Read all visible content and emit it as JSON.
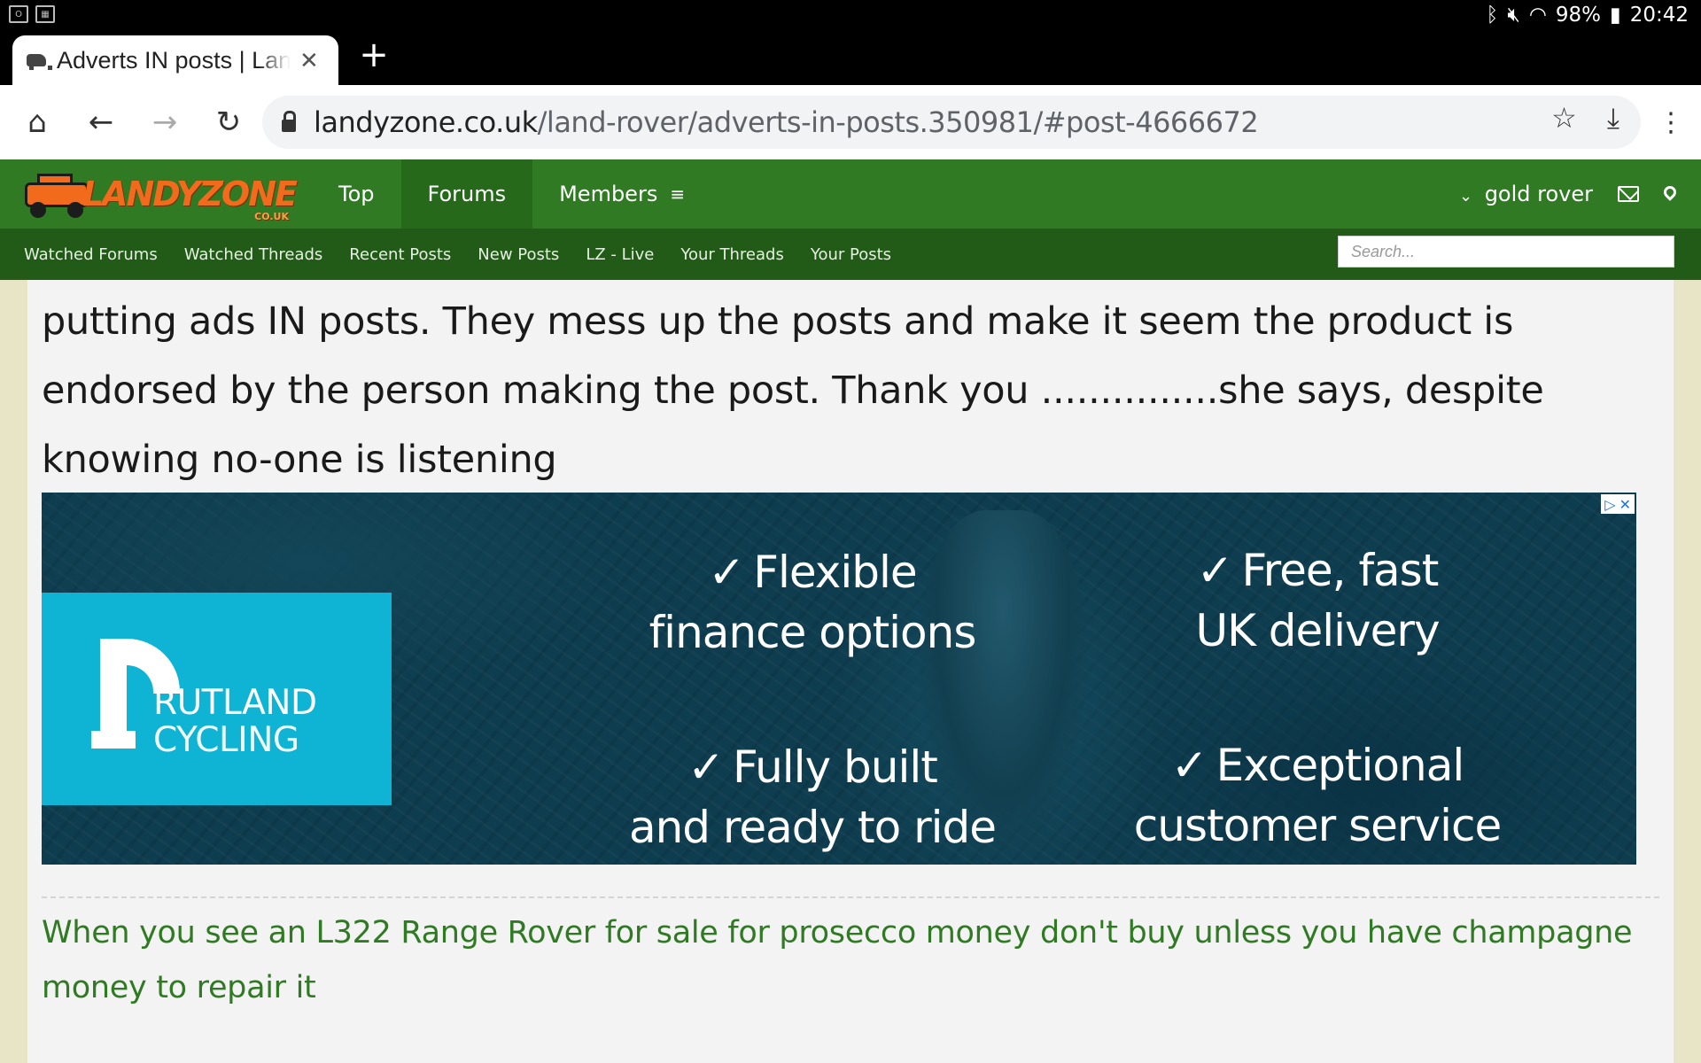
{
  "status_bar": {
    "battery": "98%",
    "time": "20:42",
    "icons": [
      "bluetooth-icon",
      "mute-icon",
      "wifi-icon",
      "battery-icon"
    ]
  },
  "browser": {
    "tab_title": "Adverts IN posts | LandyZone",
    "url_host": "landyzone.co.uk",
    "url_path": "/land-rover/adverts-in-posts.350981/#post-4666672"
  },
  "site": {
    "logo_text": "LANDYZONE",
    "logo_suffix": "CO.UK",
    "nav": [
      {
        "label": "Top"
      },
      {
        "label": "Forums"
      },
      {
        "label": "Members"
      }
    ],
    "user_name": "gold rover",
    "sub_nav": [
      "Watched Forums",
      "Watched Threads",
      "Recent Posts",
      "New Posts",
      "LZ - Live",
      "Your Threads",
      "Your Posts"
    ],
    "search_placeholder": "Search..."
  },
  "post": {
    "text": "putting ads IN posts. They mess up the posts and make it seem the product is endorsed by the person making the post. Thank you ...............she says, despite knowing no-one is listening",
    "signature": "When you see an L322 Range Rover for sale for prosecco money don't buy unless you have champagne money to repair it"
  },
  "ad": {
    "brand_line1": "RUTLAND",
    "brand_line2": "CYCLING",
    "features": [
      {
        "line1": "Flexible",
        "line2": "finance options"
      },
      {
        "line1": "Free, fast",
        "line2": "UK delivery"
      },
      {
        "line1": "Fully built",
        "line2": "and ready to ride"
      },
      {
        "line1": "Exceptional",
        "line2": "customer service"
      }
    ],
    "check_mark": "✓",
    "accent_color": "#0fb3d3"
  },
  "colors": {
    "site_green": "#2f7a23",
    "site_green_dark": "#215b17",
    "logo_orange": "#f26a1b"
  }
}
